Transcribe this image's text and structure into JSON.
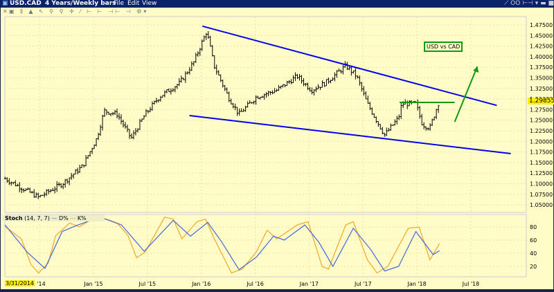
{
  "window": {
    "symbol": "USD.CAD",
    "period": "4 Years/Weekly bars",
    "menus": [
      "File",
      "Edit",
      "View"
    ],
    "controls": "⟋ OO ⊢⊣ ▾ ▬ ■ ✕"
  },
  "toolbar": {
    "icons": [
      "close-icon",
      "text-icon",
      "bars-icon",
      "mountain-icon",
      "cursor-icon",
      "zoom-in-icon",
      "zoom-out-icon",
      "crosshair-icon",
      "draw-icon",
      "scroll-left-icon",
      "scroll-start-icon",
      "scroll-both-icon",
      "scroll-end-icon",
      "settings-icon"
    ]
  },
  "price_axis": {
    "labels": [
      "1.47500",
      "1.45000",
      "1.42500",
      "1.40000",
      "1.37500",
      "1.35000",
      "1.32500",
      "1.30000",
      "1.27500",
      "1.25000",
      "1.22500",
      "1.20000",
      "1.17500",
      "1.15000",
      "1.12500",
      "1.10000",
      "1.07500",
      "1.05000"
    ],
    "current": "1.29855",
    "current_value": 1.29855,
    "range": [
      1.05,
      1.475
    ]
  },
  "annotation": {
    "label": "USD vs CAD"
  },
  "stoch": {
    "title": "Stoch",
    "params": "(14, 7, 7)",
    "d_label": "D%",
    "k_label": "K%",
    "axis": [
      "80",
      "60",
      "40",
      "20"
    ],
    "K": [
      [
        2014.18,
        81
      ],
      [
        2014.33,
        62
      ],
      [
        2014.42,
        23
      ],
      [
        2014.49,
        10
      ],
      [
        2014.58,
        25
      ],
      [
        2014.65,
        67
      ],
      [
        2014.78,
        86
      ],
      [
        2014.87,
        80
      ],
      [
        2015.03,
        97
      ],
      [
        2015.22,
        86
      ],
      [
        2015.32,
        67
      ],
      [
        2015.4,
        33
      ],
      [
        2015.48,
        42
      ],
      [
        2015.66,
        95
      ],
      [
        2015.74,
        92
      ],
      [
        2015.82,
        62
      ],
      [
        2015.96,
        88
      ],
      [
        2016.04,
        92
      ],
      [
        2016.12,
        62
      ],
      [
        2016.28,
        10
      ],
      [
        2016.38,
        16
      ],
      [
        2016.51,
        42
      ],
      [
        2016.61,
        75
      ],
      [
        2016.7,
        62
      ],
      [
        2016.89,
        83
      ],
      [
        2016.99,
        88
      ],
      [
        2017.12,
        20
      ],
      [
        2017.18,
        16
      ],
      [
        2017.34,
        83
      ],
      [
        2017.41,
        88
      ],
      [
        2017.54,
        30
      ],
      [
        2017.63,
        10
      ],
      [
        2017.73,
        20
      ],
      [
        2017.92,
        78
      ],
      [
        2018.02,
        80
      ],
      [
        2018.12,
        30
      ],
      [
        2018.21,
        55
      ]
    ],
    "D": [
      [
        2014.18,
        83
      ],
      [
        2014.39,
        41
      ],
      [
        2014.55,
        17
      ],
      [
        2014.71,
        73
      ],
      [
        2014.84,
        82
      ],
      [
        2015.06,
        95
      ],
      [
        2015.26,
        83
      ],
      [
        2015.47,
        43
      ],
      [
        2015.74,
        90
      ],
      [
        2015.9,
        66
      ],
      [
        2016.06,
        87
      ],
      [
        2016.19,
        57
      ],
      [
        2016.35,
        15
      ],
      [
        2016.51,
        34
      ],
      [
        2016.67,
        66
      ],
      [
        2016.77,
        60
      ],
      [
        2016.96,
        83
      ],
      [
        2017.09,
        57
      ],
      [
        2017.22,
        20
      ],
      [
        2017.41,
        78
      ],
      [
        2017.57,
        46
      ],
      [
        2017.7,
        13
      ],
      [
        2017.83,
        20
      ],
      [
        2017.99,
        73
      ],
      [
        2018.15,
        38
      ],
      [
        2018.21,
        44
      ]
    ]
  },
  "date_axis": {
    "cursor_date": "3/31/2014",
    "labels": [
      [
        "l '14",
        2014.5
      ],
      [
        "Jan '15",
        2015
      ],
      [
        "Jul '15",
        2015.5
      ],
      [
        "Jan '16",
        2016
      ],
      [
        "Jul '16",
        2016.5
      ],
      [
        "Jan '17",
        2017
      ],
      [
        "Jul '17",
        2017.5
      ],
      [
        "Jan '18",
        2018
      ],
      [
        "Jul '18",
        2018.5
      ]
    ]
  },
  "colors": {
    "bg": "#fffcc8",
    "trend": "#0000ee",
    "green": "#119911",
    "k": "#f5a623",
    "d": "#4466dd",
    "bars": "#000000"
  },
  "chart_data": {
    "type": "ohlc-bars",
    "title": "USD.CAD 4 Years/Weekly bars",
    "closes": [
      [
        2014.18,
        1.112
      ],
      [
        2014.49,
        1.068
      ],
      [
        2014.71,
        1.1
      ],
      [
        2014.9,
        1.142
      ],
      [
        2015.03,
        1.207
      ],
      [
        2015.1,
        1.272
      ],
      [
        2015.22,
        1.264
      ],
      [
        2015.35,
        1.207
      ],
      [
        2015.48,
        1.264
      ],
      [
        2015.61,
        1.305
      ],
      [
        2015.8,
        1.338
      ],
      [
        2015.93,
        1.387
      ],
      [
        2016.05,
        1.46
      ],
      [
        2016.12,
        1.378
      ],
      [
        2016.25,
        1.305
      ],
      [
        2016.35,
        1.264
      ],
      [
        2016.51,
        1.305
      ],
      [
        2016.7,
        1.321
      ],
      [
        2016.89,
        1.354
      ],
      [
        2017.02,
        1.321
      ],
      [
        2017.15,
        1.338
      ],
      [
        2017.34,
        1.378
      ],
      [
        2017.44,
        1.354
      ],
      [
        2017.54,
        1.289
      ],
      [
        2017.7,
        1.215
      ],
      [
        2017.83,
        1.256
      ],
      [
        2017.86,
        1.289
      ],
      [
        2017.99,
        1.289
      ],
      [
        2018.05,
        1.24
      ],
      [
        2018.12,
        1.232
      ],
      [
        2018.21,
        1.298
      ]
    ],
    "trendlines": [
      {
        "name": "upper",
        "from": [
          2016.01,
          1.472
        ],
        "to": [
          2018.74,
          1.285
        ]
      },
      {
        "name": "lower",
        "from": [
          2015.89,
          1.261
        ],
        "to": [
          2018.87,
          1.171
        ]
      },
      {
        "name": "resistance",
        "from": [
          2017.84,
          1.292
        ],
        "to": [
          2018.35,
          1.292
        ]
      },
      {
        "name": "arrow",
        "from": [
          2018.35,
          1.246
        ],
        "to": [
          2018.56,
          1.377
        ]
      }
    ]
  }
}
